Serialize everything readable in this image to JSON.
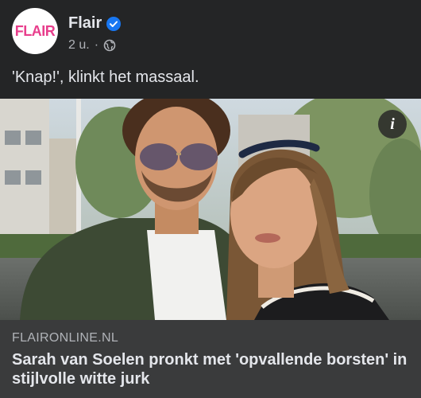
{
  "post": {
    "page_name": "Flair",
    "avatar_text": "FLAIR",
    "timestamp": "2 u.",
    "separator": "·",
    "caption": "'Knap!', klinkt het massaal.",
    "info_icon_glyph": "i",
    "icons": {
      "verified": "verified-badge-icon",
      "audience": "globe-icon",
      "info": "info-icon"
    },
    "colors": {
      "verified": "#1877f2",
      "brand": "#e83e8c"
    }
  },
  "link_preview": {
    "domain": "FLAIRONLINE.NL",
    "title": "Sarah van Soelen pronkt met 'opvallende borsten' in stijlvolle witte jurk"
  }
}
